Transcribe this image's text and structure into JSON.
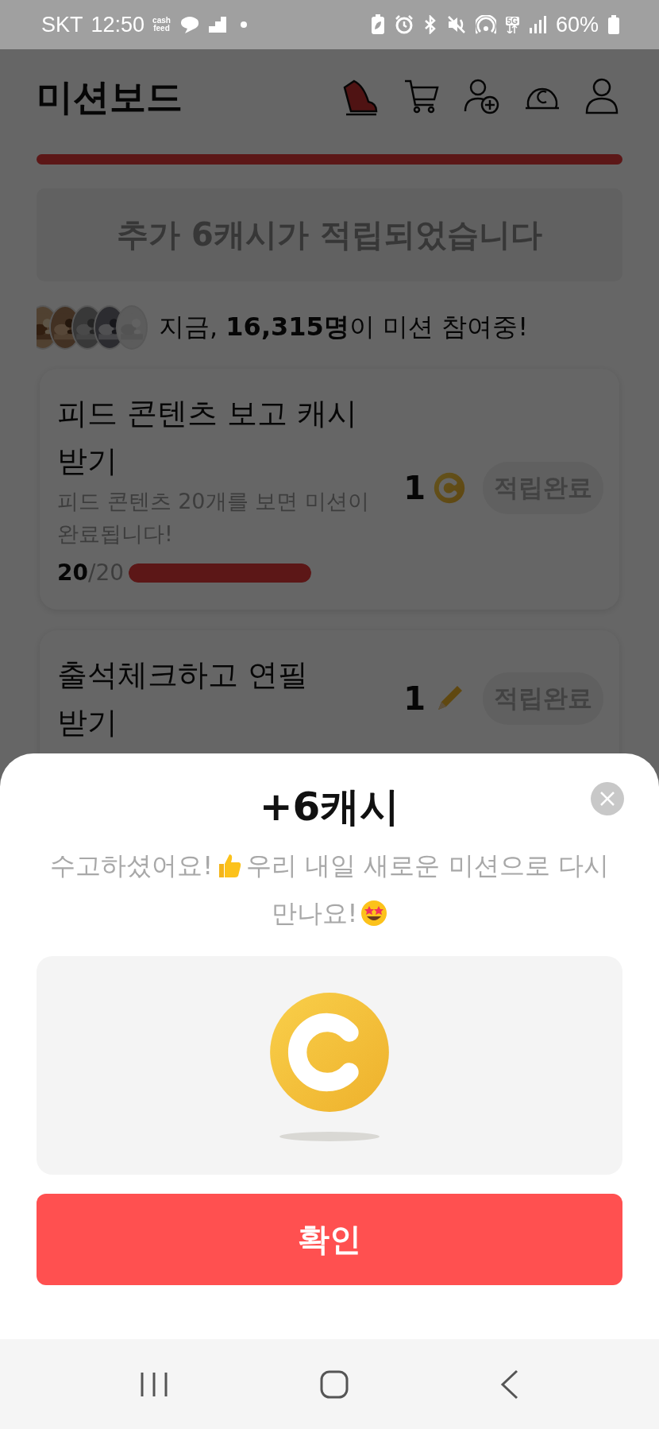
{
  "status_bar": {
    "carrier": "SKT",
    "time": "12:50",
    "app_label": [
      "cash",
      "feed"
    ],
    "network": "5G",
    "battery": "60%"
  },
  "header": {
    "title": "미션보드"
  },
  "top_progress": {
    "level": 1
  },
  "banner": {
    "text": "추가 6캐시가 적립되었습니다"
  },
  "participants": {
    "text": "지금, **16,315명**이 미션 참여중!"
  },
  "missions": [
    {
      "title": "피드 콘텐츠 보고 캐시 받기",
      "description": "피드 콘텐츠 20개를 보면 미션이 완료됩니다!",
      "progress": "**20**/20",
      "level": 1,
      "reward": "1",
      "kind": "coin",
      "button": "적립완료",
      "completed": true
    },
    {
      "title": "출석체크하고 연필 받기",
      "reward": "1",
      "kind": "pencil",
      "button": "적립완료",
      "completed": true
    }
  ],
  "sheet": {
    "title": "+6캐시",
    "message": [
      [
        {
          "kind": "text",
          "text": "수고하셨어요!"
        },
        {
          "kind": "thumbs"
        },
        {
          "kind": "text",
          "text": "우리 내일 새로운 미션으로 다시"
        }
      ],
      [
        {
          "kind": "text",
          "text": "만나요!"
        },
        {
          "kind": "star_face"
        }
      ]
    ],
    "confirm": "확인"
  }
}
